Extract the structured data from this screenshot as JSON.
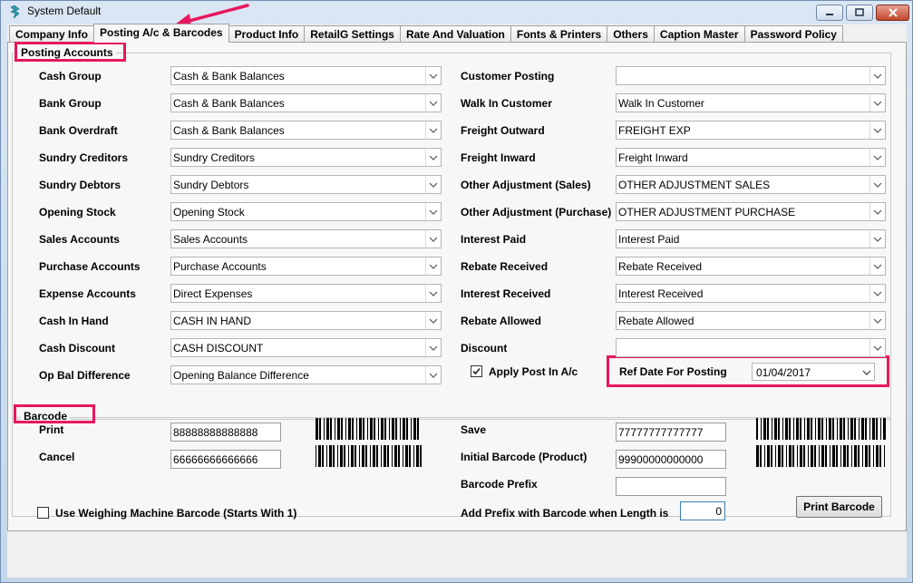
{
  "window": {
    "title": "System Default"
  },
  "tabs": [
    "Company Info",
    "Posting A/c & Barcodes",
    "Product Info",
    "RetailG Settings",
    "Rate And Valuation",
    "Fonts & Printers",
    "Others",
    "Caption Master",
    "Password Policy"
  ],
  "posting": {
    "title": "Posting Accounts",
    "left": [
      {
        "label": "Cash Group",
        "value": "Cash & Bank Balances"
      },
      {
        "label": "Bank Group",
        "value": "Cash & Bank Balances"
      },
      {
        "label": "Bank Overdraft",
        "value": "Cash & Bank Balances"
      },
      {
        "label": "Sundry Creditors",
        "value": "Sundry Creditors"
      },
      {
        "label": "Sundry Debtors",
        "value": "Sundry Debtors"
      },
      {
        "label": "Opening Stock",
        "value": "Opening Stock"
      },
      {
        "label": "Sales Accounts",
        "value": "Sales Accounts"
      },
      {
        "label": "Purchase Accounts",
        "value": "Purchase Accounts"
      },
      {
        "label": "Expense Accounts",
        "value": "Direct Expenses"
      },
      {
        "label": "Cash In Hand",
        "value": "CASH IN HAND"
      },
      {
        "label": "Cash Discount",
        "value": "CASH DISCOUNT"
      },
      {
        "label": "Op Bal Difference",
        "value": "Opening Balance Difference"
      }
    ],
    "right": [
      {
        "label": "Customer Posting",
        "value": ""
      },
      {
        "label": "Walk In Customer",
        "value": "Walk In Customer"
      },
      {
        "label": "Freight Outward",
        "value": "FREIGHT EXP"
      },
      {
        "label": "Freight Inward",
        "value": "Freight Inward"
      },
      {
        "label": "Other Adjustment (Sales)",
        "value": "OTHER ADJUSTMENT SALES"
      },
      {
        "label": "Other Adjustment (Purchase)",
        "value": "OTHER ADJUSTMENT PURCHASE"
      },
      {
        "label": "Interest Paid",
        "value": "Interest Paid"
      },
      {
        "label": "Rebate Received",
        "value": "Rebate Received"
      },
      {
        "label": "Interest Received",
        "value": "Interest Received"
      },
      {
        "label": "Rebate Allowed",
        "value": "Rebate Allowed"
      },
      {
        "label": "Discount",
        "value": ""
      }
    ],
    "apply_post_label": "Apply Post In A/c",
    "apply_post_checked": true,
    "ref_date_label": "Ref Date For Posting",
    "ref_date_value": "01/04/2017"
  },
  "barcode": {
    "title": "Barcode",
    "print_label": "Print",
    "print_value": "88888888888888",
    "cancel_label": "Cancel",
    "cancel_value": "66666666666666",
    "save_label": "Save",
    "save_value": "77777777777777",
    "initial_label": "Initial Barcode (Product)",
    "initial_value": "99900000000000",
    "prefix_label": "Barcode Prefix",
    "prefix_value": "",
    "prefix_length_label": "Add Prefix with Barcode when Length is",
    "prefix_length_value": "0",
    "weighing_label": "Use Weighing Machine Barcode (Starts With 1)",
    "weighing_checked": false,
    "print_button": "Print Barcode"
  },
  "colors": {
    "highlight": "#e8175d",
    "panel": "#f7f7f7"
  },
  "icons": {
    "app": "app-logo-icon",
    "minimize": "minimize-icon",
    "maximize": "maximize-icon",
    "close": "close-icon",
    "dropdown": "chevron-down-icon",
    "check": "checkmark-icon"
  }
}
